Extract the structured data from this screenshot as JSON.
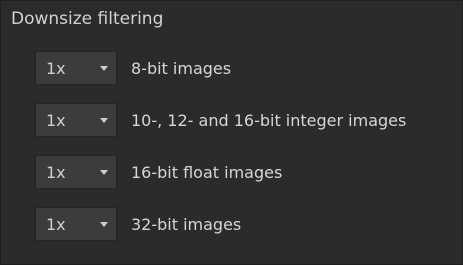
{
  "panel": {
    "title": "Downsize filtering"
  },
  "rows": [
    {
      "value": "1x",
      "label": "8-bit images",
      "arrow_icon": "chevron-down-icon"
    },
    {
      "value": "1x",
      "label": "10-, 12- and 16-bit integer images",
      "arrow_icon": "chevron-down-icon"
    },
    {
      "value": "1x",
      "label": "16-bit float images",
      "arrow_icon": "chevron-down-icon"
    },
    {
      "value": "1x",
      "label": "32-bit images",
      "arrow_icon": "chevron-down-icon"
    }
  ]
}
